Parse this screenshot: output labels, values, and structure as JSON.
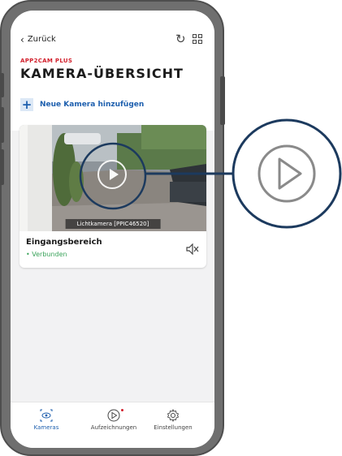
{
  "header": {
    "back_label": "Zurück",
    "brand": "APP2CAM PLUS",
    "title": "KAMERA-ÜBERSICHT"
  },
  "actions": {
    "add_camera_label": "Neue Kamera hinzufügen"
  },
  "cameras": [
    {
      "feed_label": "Lichtkamera [PPIC46520]",
      "name": "Eingangsbereich",
      "status": "• Verbunden"
    }
  ],
  "bottom_nav": {
    "items": [
      {
        "label": "Kameras"
      },
      {
        "label": "Aufzeichnungen"
      },
      {
        "label": "Einstellungen"
      }
    ]
  },
  "colors": {
    "accent_blue": "#1d5fae",
    "brand_red": "#d21f2b",
    "status_green": "#3aa35a",
    "callout_navy": "#1c3a5e"
  },
  "icons": [
    "chevron-left-icon",
    "refresh-icon",
    "grid-icon",
    "plus-icon",
    "play-icon",
    "mute-icon",
    "eye-icon",
    "gear-icon"
  ]
}
